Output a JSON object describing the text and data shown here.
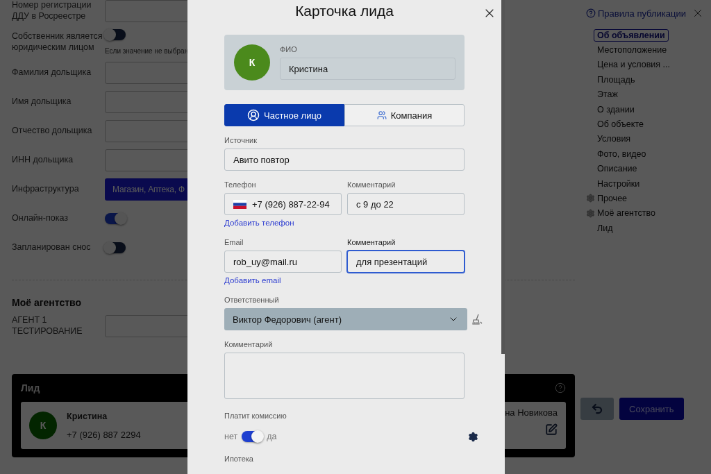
{
  "page": {
    "rules_link": "Правила публикации",
    "form_rows": [
      {
        "kind": "field",
        "label": "Номер регистрации ДДУ в Росреестре"
      },
      {
        "kind": "toggle",
        "label": "Собственник является юридическим лицом",
        "on": false,
        "note": "Если значение не выбран"
      },
      {
        "kind": "field",
        "label": "Фамилия дольщика"
      },
      {
        "kind": "field",
        "label": "Имя дольщика"
      },
      {
        "kind": "field",
        "label": "Отчество дольщика"
      },
      {
        "kind": "field",
        "label": "ИНН дольщика"
      },
      {
        "kind": "chips",
        "label": "Инфраструктура",
        "value": "Магазин, Аптека, Ф"
      },
      {
        "kind": "toggle",
        "label": "Онлайн-показ",
        "on": true
      },
      {
        "kind": "toggle",
        "label": "Запланирован снос",
        "on": false
      }
    ],
    "agency": {
      "title": "Моё агентство",
      "rows": [
        {
          "label": "АГЕНТ 1 ТЕСТИРОВАНИЕ"
        }
      ]
    },
    "nav": [
      {
        "label": "Об объявлении",
        "selected": true,
        "kind": "plain"
      },
      {
        "label": "Местоположение",
        "selected": false,
        "kind": "plain"
      },
      {
        "label": "Цена и условия ...",
        "selected": false,
        "kind": "plain"
      },
      {
        "label": "Площадь",
        "selected": false,
        "kind": "plain"
      },
      {
        "label": "Этаж",
        "selected": false,
        "kind": "plain"
      },
      {
        "label": "О здании",
        "selected": false,
        "kind": "plain"
      },
      {
        "label": "Об объекте",
        "selected": false,
        "kind": "plain"
      },
      {
        "label": "Условия",
        "selected": false,
        "kind": "plain"
      },
      {
        "label": "Фото, видео",
        "selected": false,
        "kind": "plain"
      },
      {
        "label": "Описание",
        "selected": false,
        "kind": "plain"
      },
      {
        "label": "Настройки",
        "selected": false,
        "kind": "plain"
      },
      {
        "label": "Прочее",
        "selected": false,
        "kind": "gear"
      },
      {
        "label": "Моё агентство",
        "selected": false,
        "kind": "gear"
      },
      {
        "label": "Лид",
        "selected": false,
        "kind": "plain"
      }
    ],
    "lead": {
      "title": "Лид",
      "initial": "К",
      "name": "Кристина",
      "phone": "+7 (926) 887 2294",
      "agent_name": "на Новикова"
    },
    "save_button": "Сохранить"
  },
  "modal": {
    "title": "Карточка лида",
    "person": {
      "initial": "К",
      "label": "ФИО",
      "value": "Кристина"
    },
    "tabs": [
      {
        "label": "Частное лицо",
        "selected": true,
        "kind": "person"
      },
      {
        "label": "Компания",
        "selected": false,
        "kind": "company"
      }
    ],
    "source": {
      "label": "Источник",
      "value": "Авито повтор"
    },
    "contacts": [
      {
        "kind": "phone",
        "label": "Телефон",
        "value": "+7 (926) 887-22-94",
        "comment_label": "Комментарий",
        "comment_value": "с 9 до 22",
        "focused": false,
        "add_link": "Добавить телефон"
      },
      {
        "kind": "email",
        "label": "Email",
        "value": "rob_uy@mail.ru",
        "comment_label": "Комментарий",
        "comment_value": "для презентаций",
        "focused": true,
        "add_link": "Добавить email"
      }
    ],
    "responsible": {
      "label": "Ответственный",
      "value": "Виктор Федорович (агент)"
    },
    "comment": {
      "label": "Комментарий"
    },
    "commission": {
      "label": "Платит комиссию",
      "off_label": "нет",
      "on_label": "да",
      "on": true
    },
    "mortgage": {
      "label": "Ипотека"
    }
  }
}
